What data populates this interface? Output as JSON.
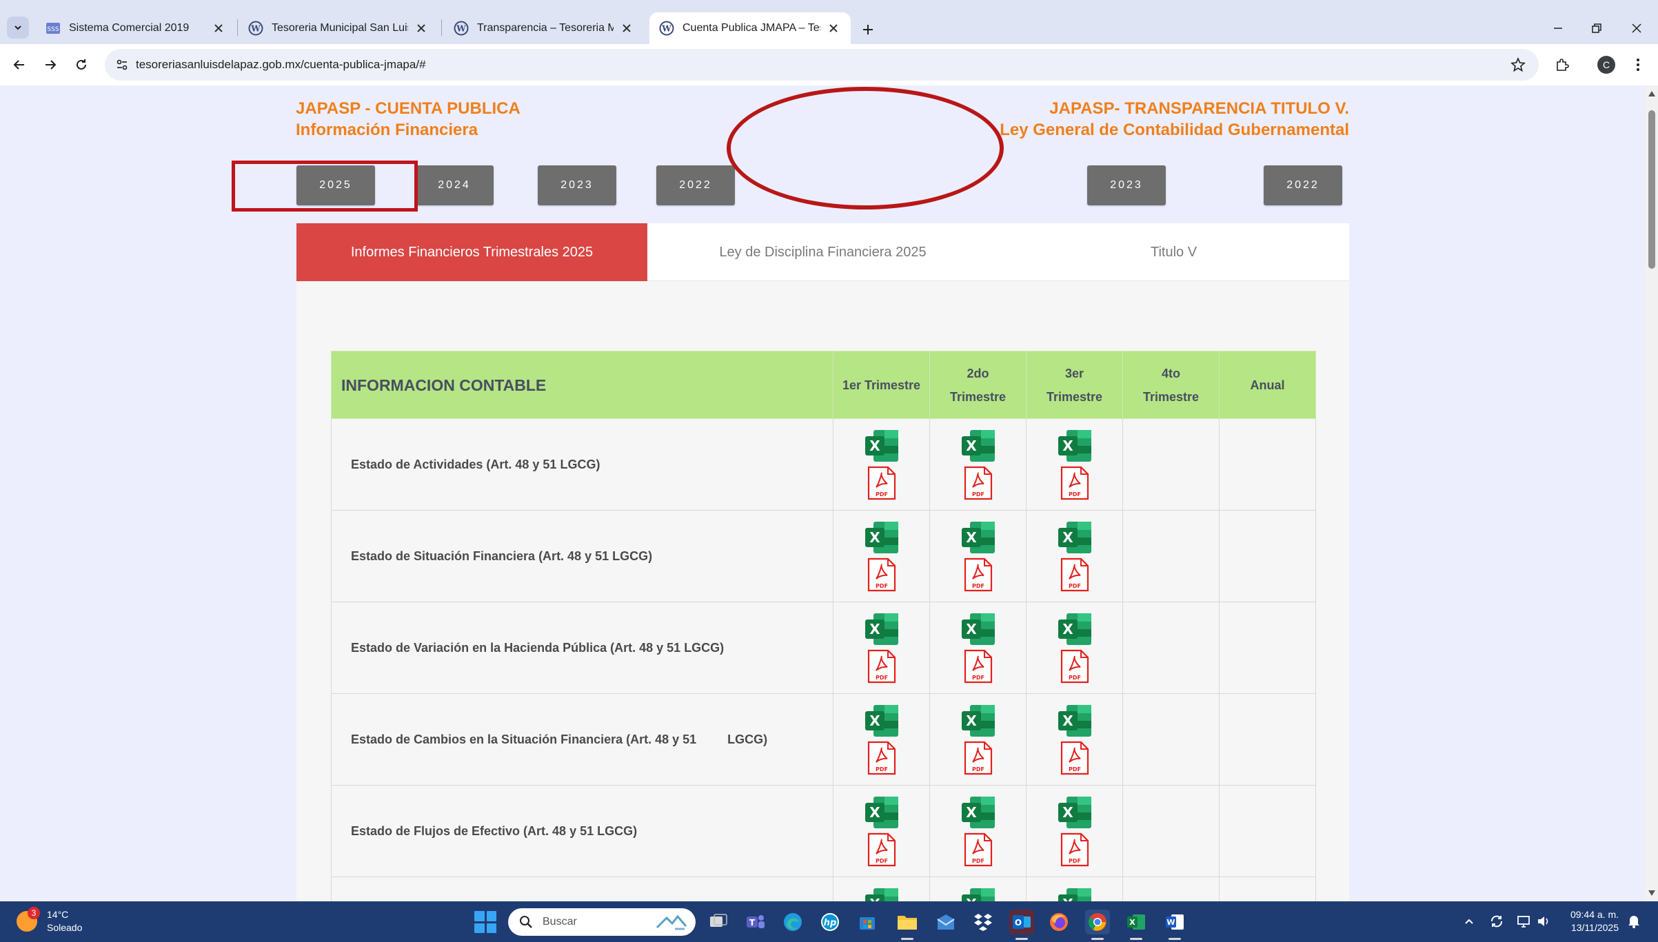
{
  "browser": {
    "tabs": [
      {
        "title": "Sistema Comercial 2019",
        "icon": "sss-icon"
      },
      {
        "title": "Tesoreria Municipal San Luis de",
        "icon": "wordpress-icon"
      },
      {
        "title": "Transparencia – Tesoreria Munic",
        "icon": "wordpress-icon"
      },
      {
        "title": "Cuenta Publica JMAPA – Tesore",
        "icon": "wordpress-icon",
        "active": true
      }
    ],
    "new_tab_label": "+",
    "url": "tesoreriasanluisdelapaz.gob.mx/cuenta-publica-jmapa/#",
    "profile_initial": "C"
  },
  "page": {
    "left_header": {
      "line1": "JAPASP - CUENTA PUBLICA",
      "line2": "Información Financiera"
    },
    "right_header": {
      "line1": "JAPASP- TRANSPARENCIA TITULO V.",
      "line2": "Ley General de Contabilidad Gubernamental"
    },
    "left_years": [
      "2025",
      "2024",
      "2023",
      "2022"
    ],
    "right_years": [
      "2023",
      "2022"
    ],
    "selected_year": "2025",
    "content_tabs": [
      {
        "label": "Informes Financieros Trimestrales 2025",
        "active": true
      },
      {
        "label": "Ley de Disciplina Financiera 2025",
        "active": false
      },
      {
        "label": "Titulo V",
        "active": false
      }
    ],
    "table": {
      "title": "INFORMACION CONTABLE",
      "columns": [
        {
          "l1": "1er Trimestre",
          "l2": ""
        },
        {
          "l1": "2do",
          "l2": "Trimestre"
        },
        {
          "l1": "3er",
          "l2": "Trimestre"
        },
        {
          "l1": "4to",
          "l2": "Trimestre"
        },
        {
          "l1": "Anual",
          "l2": ""
        }
      ],
      "rows": [
        {
          "label": "Estado de Actividades (Art. 48 y 51 LGCG)",
          "files": [
            true,
            true,
            true,
            false,
            false
          ]
        },
        {
          "label": "Estado de Situación Financiera (Art. 48 y 51 LGCG)",
          "files": [
            true,
            true,
            true,
            false,
            false
          ]
        },
        {
          "label": "Estado de Variación en la Hacienda Pública (Art. 48 y 51 LGCG)",
          "files": [
            true,
            true,
            true,
            false,
            false
          ]
        },
        {
          "label": "Estado de Cambios en la Situación Financiera (Art. 48 y 51         LGCG)",
          "files": [
            true,
            true,
            true,
            false,
            false
          ]
        },
        {
          "label": "Estado de Flujos de Efectivo (Art. 48 y 51 LGCG)",
          "files": [
            true,
            true,
            true,
            false,
            false
          ]
        },
        {
          "label": "",
          "files": [
            true,
            true,
            true,
            false,
            false
          ]
        }
      ],
      "file_labels": {
        "excel": "X",
        "pdf": "PDF"
      }
    }
  },
  "taskbar": {
    "weather_badge": "3",
    "temperature": "14°C",
    "condition": "Soleado",
    "search_placeholder": "Buscar",
    "time": "09:44 a. m.",
    "date": "13/11/2025"
  },
  "colors": {
    "header_orange": "#f07f1a",
    "year_button": "#6e6e6e",
    "active_tab": "#d94644",
    "table_header": "#b5e585",
    "annotation_red": "#c0141b"
  }
}
